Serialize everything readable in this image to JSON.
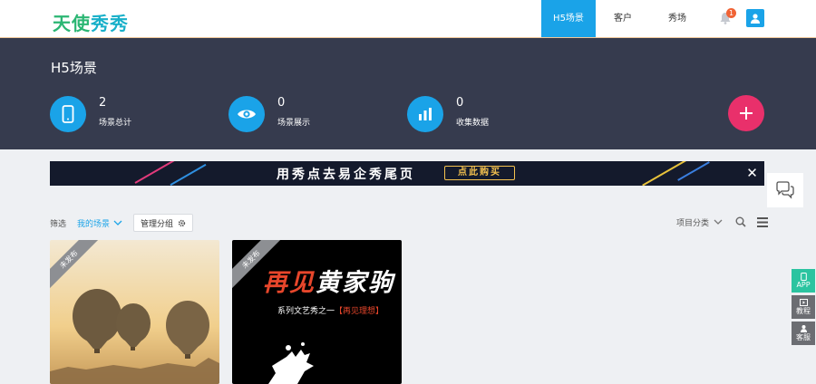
{
  "logo": {
    "part1": "天使",
    "part2": "秀秀"
  },
  "nav": {
    "items": [
      {
        "label": "H5场景"
      },
      {
        "label": "客户"
      },
      {
        "label": "秀场"
      }
    ]
  },
  "notifications": {
    "count": "1"
  },
  "hero": {
    "title": "H5场景",
    "stats": [
      {
        "value": "2",
        "label": "场景总计",
        "icon": "phone-icon"
      },
      {
        "value": "0",
        "label": "场景展示",
        "icon": "eye-icon"
      },
      {
        "value": "0",
        "label": "收集数据",
        "icon": "bar-chart-icon"
      }
    ]
  },
  "banner": {
    "text": "用秀点去易企秀尾页",
    "button": "点此购买"
  },
  "filter": {
    "label": "筛选",
    "mine": "我的场景",
    "manage": "管理分组",
    "category": "项目分类"
  },
  "cards": [
    {
      "status": "未发布"
    },
    {
      "status": "未发布",
      "title_a": "再见",
      "title_b": "黄家驹",
      "subtitle_a": "系列文艺秀之一",
      "subtitle_b": "【再见理想】"
    }
  ],
  "side": {
    "app": "APP",
    "tutorial": "教程",
    "service": "客服"
  },
  "colors": {
    "accent": "#1aa3e8",
    "hero_bg": "#363b4e",
    "add": "#e9306b",
    "green": "#2bb673"
  }
}
